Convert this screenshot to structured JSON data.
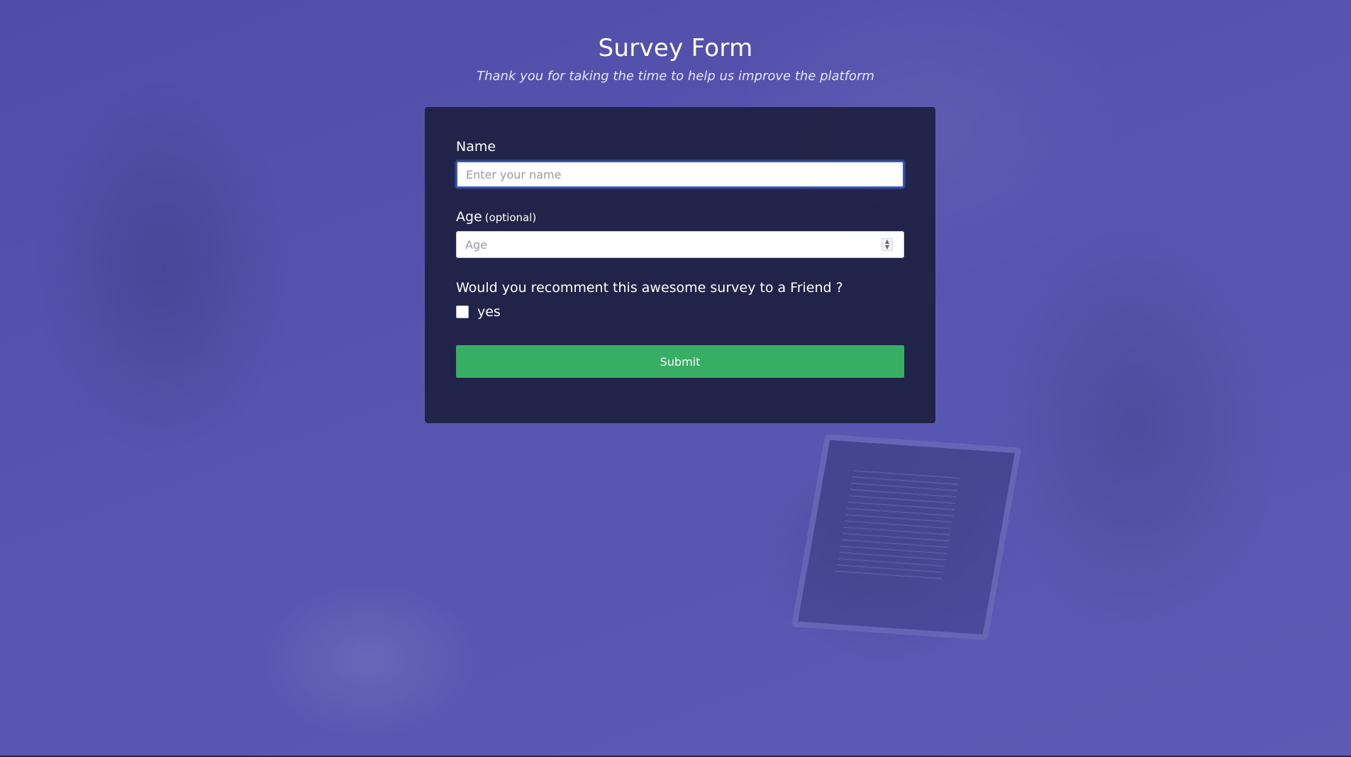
{
  "header": {
    "title": "Survey Form",
    "description": "Thank you for taking the time to help us improve the platform"
  },
  "form": {
    "name": {
      "label": "Name",
      "placeholder": "Enter your name",
      "value": ""
    },
    "age": {
      "label": "Age",
      "label_note": "(optional)",
      "placeholder": "Age",
      "value": ""
    },
    "recommend": {
      "question": "Would you recomment this awesome survey to a Friend ?",
      "option_label": "yes",
      "checked": false
    },
    "submit_label": "Submit"
  },
  "colors": {
    "card_background": "#1b1c3a",
    "submit_button": "#37ae63",
    "focus_border": "#2f5bd6",
    "background_overlay": "#504eaa"
  }
}
